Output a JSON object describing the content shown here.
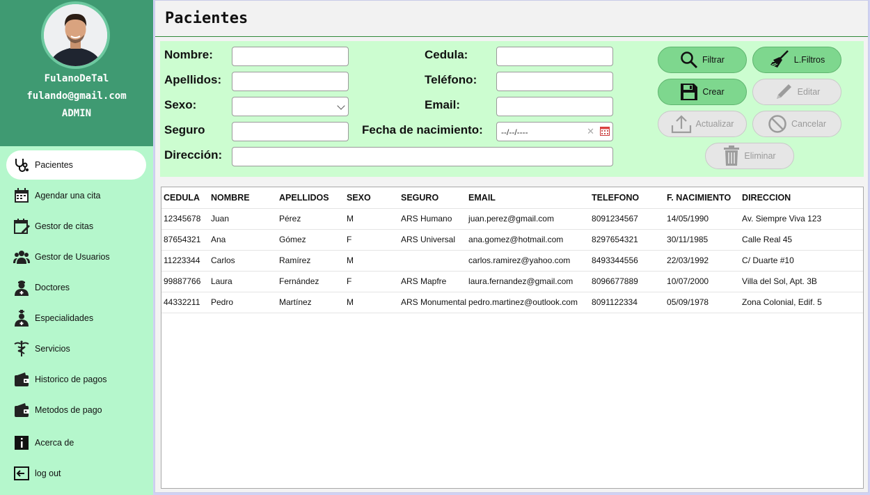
{
  "profile": {
    "name": "FulanoDeTal",
    "email": "fulando@gmail.com",
    "role": "ADMIN"
  },
  "nav": {
    "items": [
      {
        "label": "Pacientes",
        "icon": "stethoscope-icon",
        "active": true
      },
      {
        "label": "Agendar una cita",
        "icon": "calendar-icon"
      },
      {
        "label": "Gestor de citas",
        "icon": "calendar-edit-icon"
      },
      {
        "label": "Gestor de Usuarios",
        "icon": "users-icon"
      },
      {
        "label": "Doctores",
        "icon": "doctor-icon"
      },
      {
        "label": "Especialidades",
        "icon": "specialist-icon"
      },
      {
        "label": "Servicios",
        "icon": "caduceus-icon"
      },
      {
        "label": "Historico de pagos",
        "icon": "wallet-icon"
      },
      {
        "label": "Metodos de pago",
        "icon": "wallet-icon"
      },
      {
        "label": "Acerca de",
        "icon": "info-icon"
      },
      {
        "label": "log out",
        "icon": "logout-icon"
      }
    ]
  },
  "page": {
    "title": "Pacientes"
  },
  "form": {
    "nombre_label": "Nombre:",
    "apellidos_label": "Apellidos:",
    "sexo_label": "Sexo:",
    "seguro_label": "Seguro",
    "direccion_label": "Dirección:",
    "cedula_label": "Cedula:",
    "telefono_label": "Teléfono:",
    "email_label": "Email:",
    "fecha_label": "Fecha de nacimiento:",
    "fecha_placeholder": "--/--/----",
    "nombre_value": "",
    "apellidos_value": "",
    "seguro_value": "",
    "direccion_value": "",
    "cedula_value": "",
    "telefono_value": "",
    "email_value": ""
  },
  "buttons": {
    "filtrar": "Filtrar",
    "limpiar": "L.Filtros",
    "crear": "Crear",
    "editar": "Editar",
    "actualizar": "Actualizar",
    "cancelar": "Cancelar",
    "eliminar": "Eliminar"
  },
  "table": {
    "headers": [
      "CEDULA",
      "NOMBRE",
      "APELLIDOS",
      "SEXO",
      "SEGURO",
      "EMAIL",
      "TELEFONO",
      "F. NACIMIENTO",
      "DIRECCION"
    ],
    "rows": [
      [
        "12345678",
        "Juan",
        "Pérez",
        "M",
        "ARS Humano",
        "juan.perez@gmail.com",
        "8091234567",
        "14/05/1990",
        "Av. Siempre Viva 123"
      ],
      [
        "87654321",
        "Ana",
        "Gómez",
        "F",
        "ARS Universal",
        "ana.gomez@hotmail.com",
        "8297654321",
        "30/11/1985",
        "Calle Real 45"
      ],
      [
        "11223344",
        "Carlos",
        "Ramírez",
        "M",
        "",
        "carlos.ramirez@yahoo.com",
        "8493344556",
        "22/03/1992",
        "C/ Duarte #10"
      ],
      [
        "99887766",
        "Laura",
        "Fernández",
        "F",
        "ARS Mapfre",
        "laura.fernandez@gmail.com",
        "8096677889",
        "10/07/2000",
        "Villa del Sol, Apt. 3B"
      ],
      [
        "44332211",
        "Pedro",
        "Martínez",
        "M",
        "ARS Monumental",
        "pedro.martinez@outlook.com",
        "8091122334",
        "05/09/1978",
        "Zona Colonial, Edif. 5"
      ]
    ]
  },
  "colors": {
    "profile_bg": "#3f9a72",
    "sidebar_bg": "#b5f7cc",
    "form_bg": "#ccfdd0",
    "button_green": "#7ed78e"
  }
}
